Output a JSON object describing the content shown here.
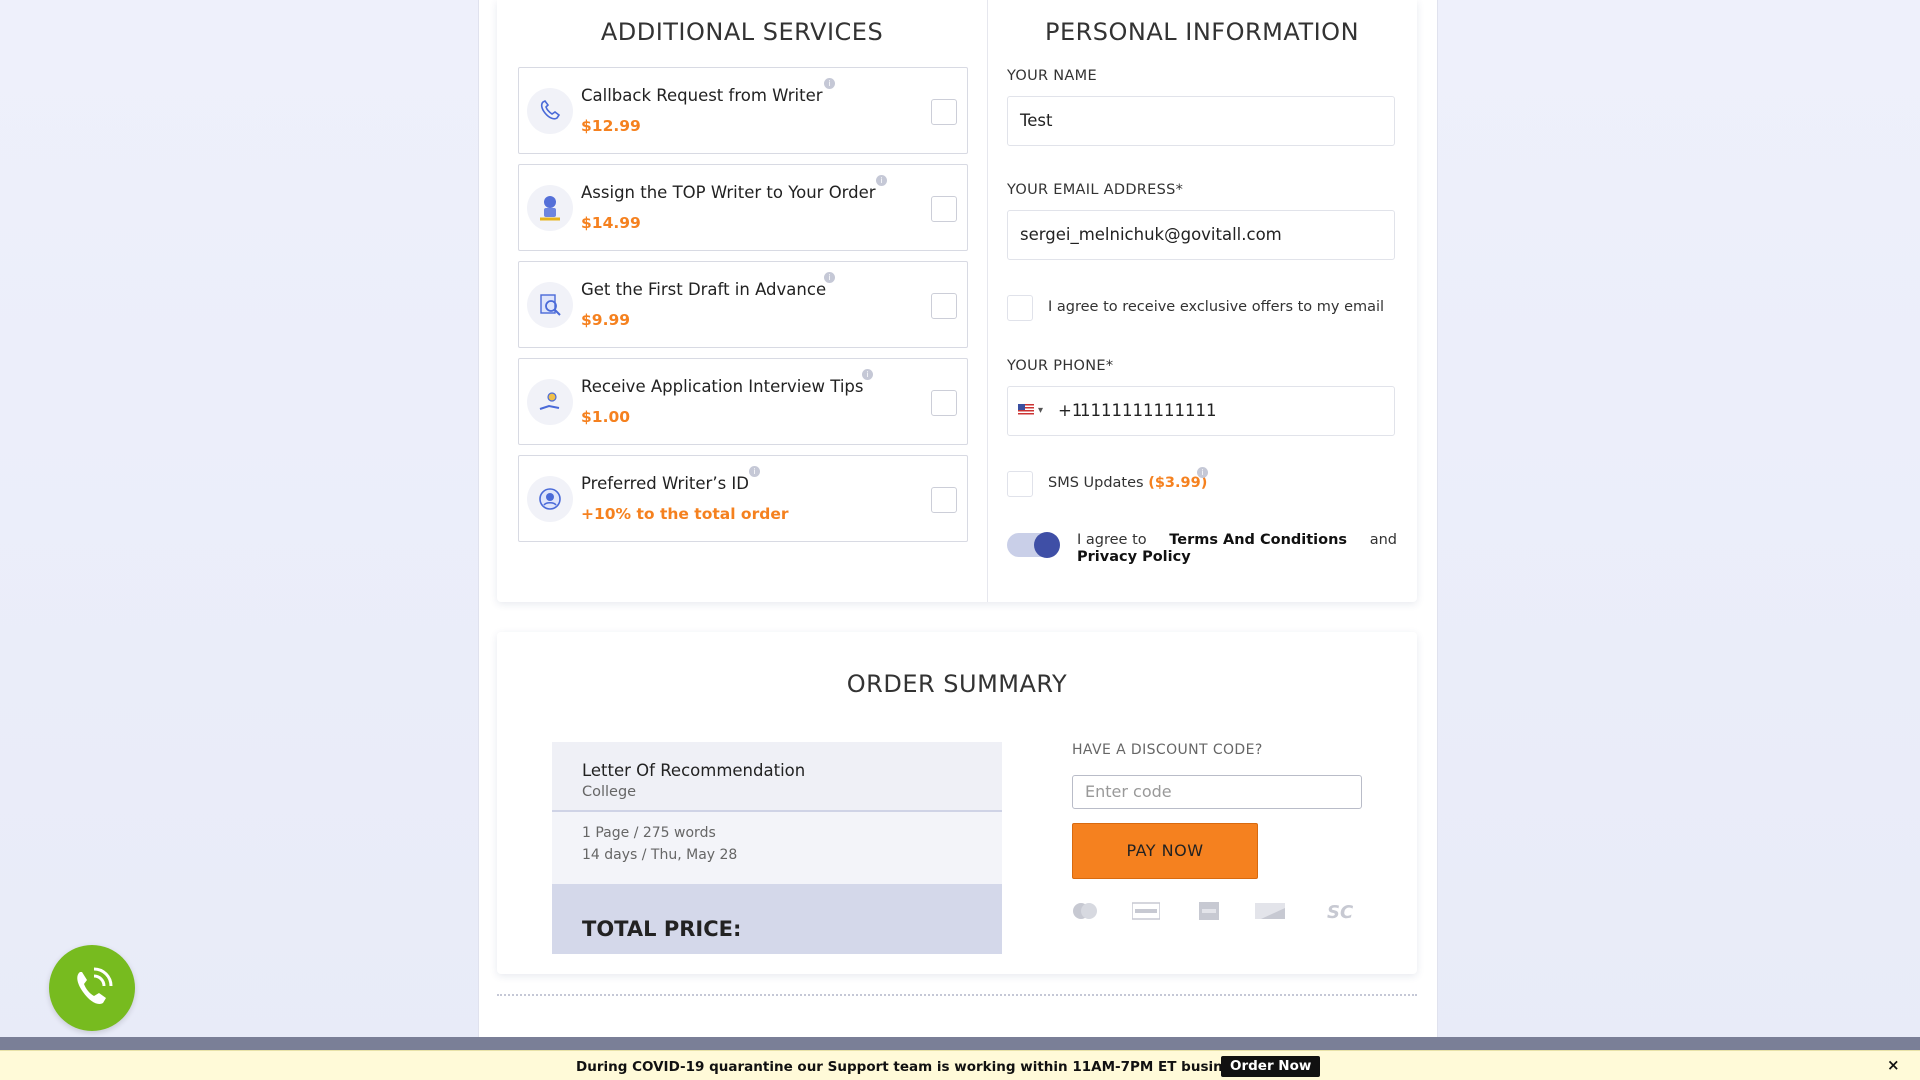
{
  "additional_services": {
    "title": "ADDITIONAL SERVICES",
    "items": [
      {
        "name": "Callback Request from Writer",
        "price": "$12.99",
        "icon": "phone-icon"
      },
      {
        "name": "Assign the TOP Writer to Your Order",
        "price": "$14.99",
        "icon": "top-writer-icon"
      },
      {
        "name": "Get the First Draft in Advance",
        "price": "$9.99",
        "icon": "draft-icon"
      },
      {
        "name": "Receive Application Interview Tips",
        "price": "$1.00",
        "icon": "tips-icon"
      },
      {
        "name": "Preferred Writer’s ID",
        "price": "+10% to the total order",
        "icon": "writer-id-icon"
      }
    ]
  },
  "personal_info": {
    "title": "PERSONAL INFORMATION",
    "name_label": "YOUR NAME",
    "name_value": "Test",
    "email_label": "YOUR EMAIL ADDRESS*",
    "email_value": "sergei_melnichuk@govitall.com",
    "offers_text": "I agree to receive exclusive offers to my email",
    "phone_label": "YOUR PHONE*",
    "phone_code": "+1",
    "phone_value": "1111111111111",
    "sms_text": "SMS Updates",
    "sms_price": "($3.99)",
    "terms_prefix": "I agree to",
    "terms_link": "Terms And Conditions",
    "terms_and": "and",
    "privacy_link": "Privacy Policy"
  },
  "order_summary": {
    "title": "ORDER SUMMARY",
    "product": "Letter Of Recommendation",
    "level": "College",
    "pages": "1 Page / 275 words",
    "deadline": "14 days / Thu, May 28",
    "total_label": "TOTAL PRICE:",
    "discount_label": "HAVE A DISCOUNT CODE?",
    "discount_placeholder": "Enter code",
    "pay_label": "PAY NOW",
    "payment_icons": [
      "mastercard-icon",
      "visa-icon",
      "amex-icon",
      "discover-icon",
      "sc-icon"
    ],
    "sc_label": "SC"
  },
  "banner": {
    "text": "During COVID-19 quarantine our Support team is working within 11AM-7PM ET business hours",
    "order_now": "Order Now",
    "close": "×"
  },
  "colors": {
    "accent": "#f5811f",
    "toggle": "#3f4fa6",
    "call_button": "#77bb1f"
  }
}
